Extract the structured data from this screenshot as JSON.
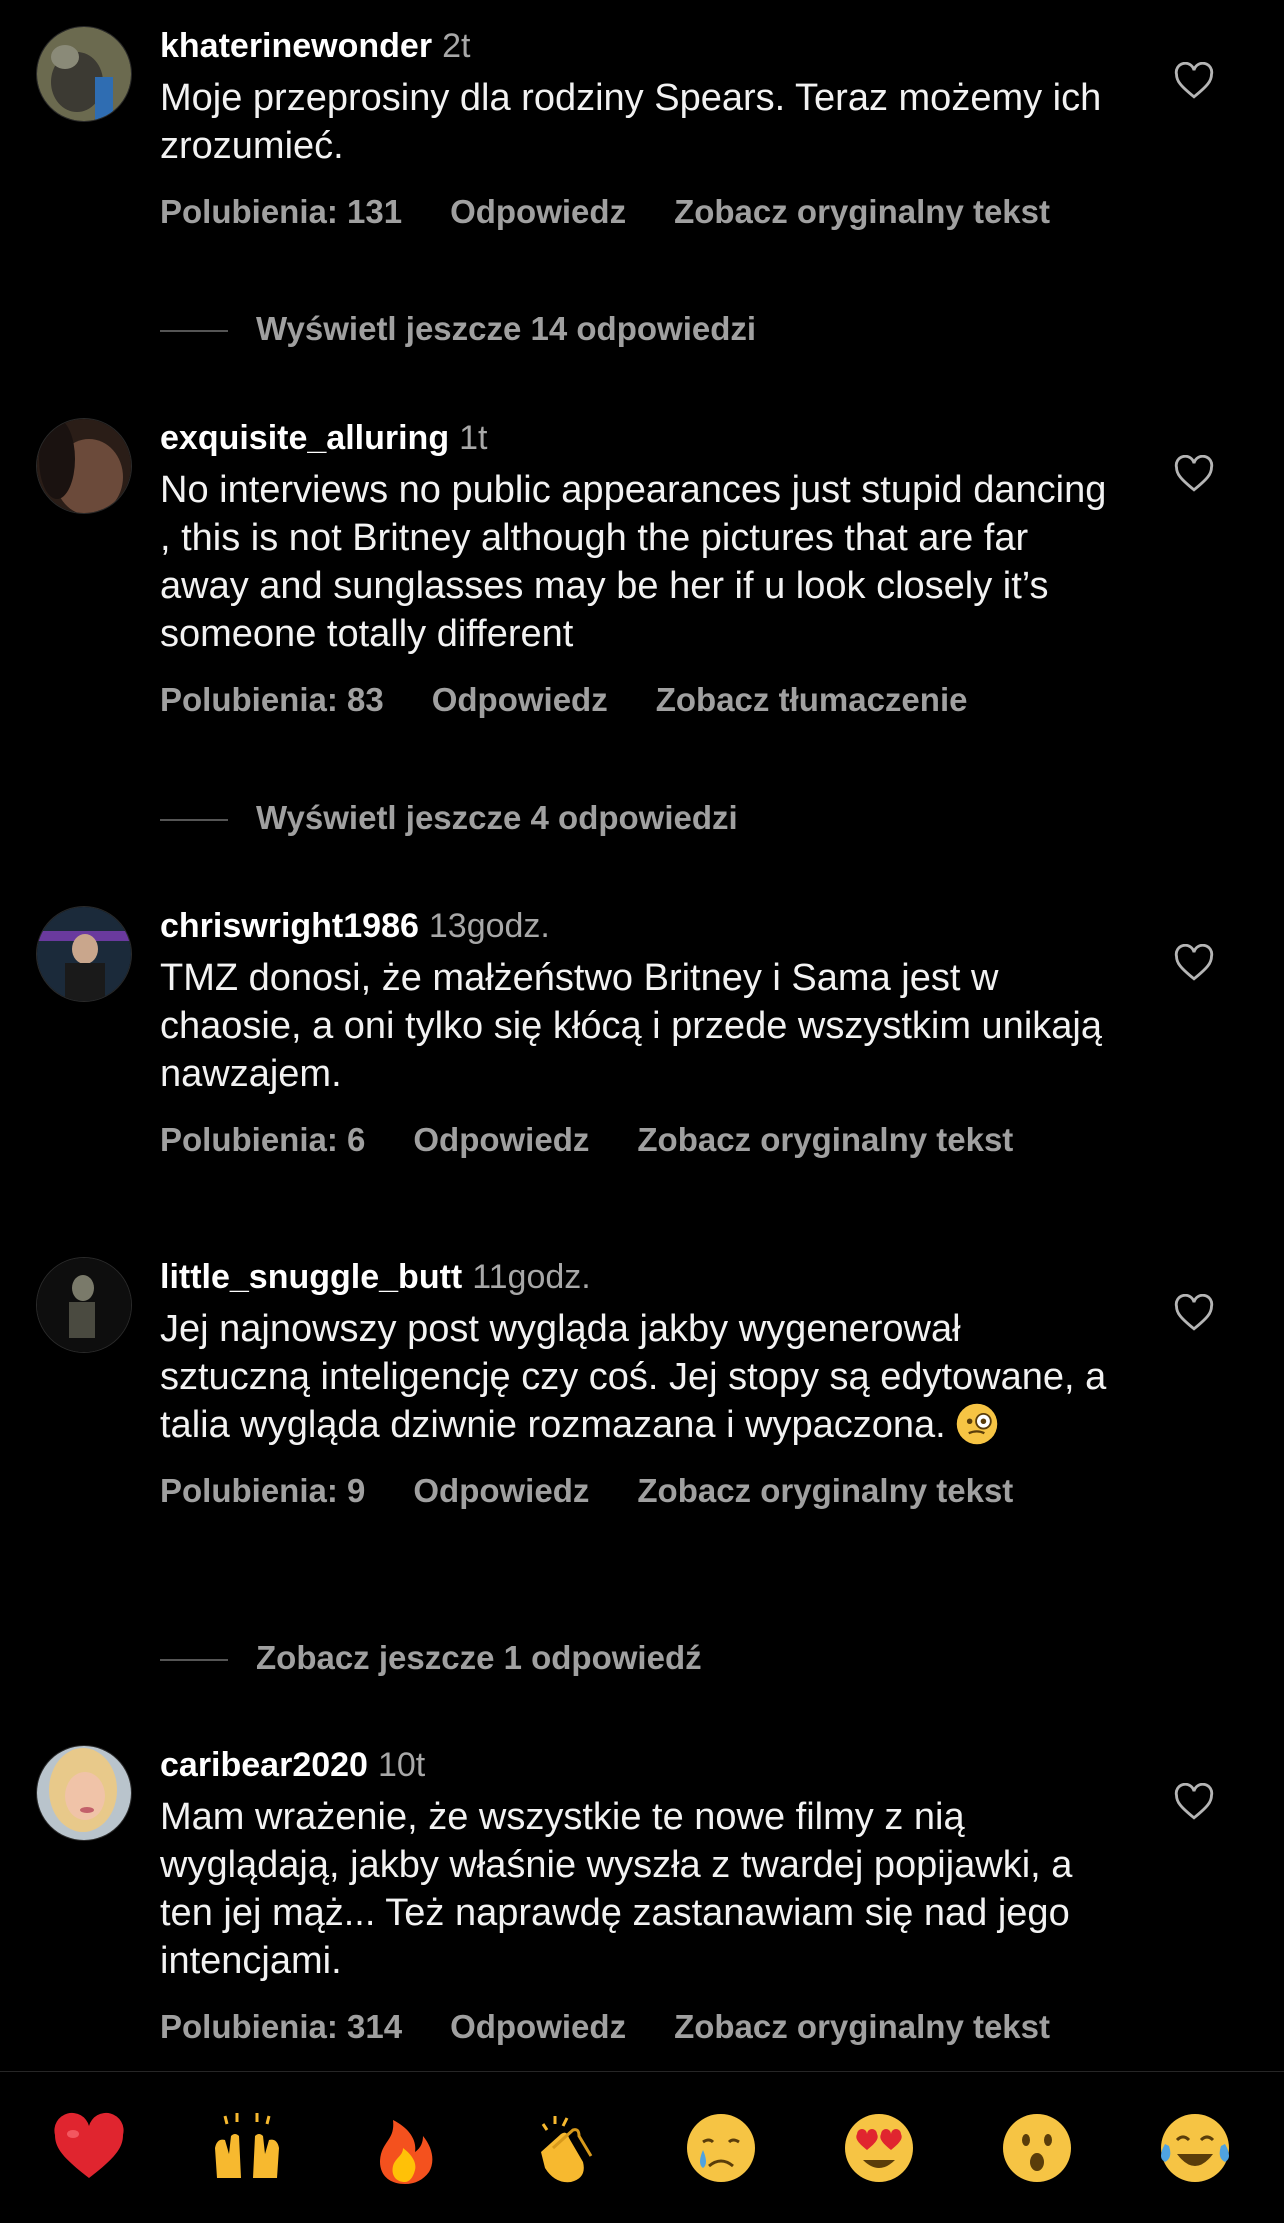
{
  "comments": [
    {
      "username": "khaterinewonder",
      "time": "2t",
      "text": "Moje przeprosiny dla rodziny Spears. Teraz możemy ich zrozumieć.",
      "likes": "Polubienia: 131",
      "reply": "Odpowiedz",
      "translate": "Zobacz oryginalny tekst",
      "more_replies": "Wyświetl jeszcze 14 odpowiedzi"
    },
    {
      "username": "exquisite_alluring",
      "time": "1t",
      "text": "No interviews no public appearances just stupid dancing , this is not Britney although the pictures that are far away and sunglasses may be her if u look closely it’s someone totally different",
      "likes": "Polubienia: 83",
      "reply": "Odpowiedz",
      "translate": "Zobacz tłumaczenie",
      "more_replies": "Wyświetl jeszcze 4 odpowiedzi"
    },
    {
      "username": "chriswright1986",
      "time": "13godz.",
      "text": "TMZ donosi, że małżeństwo Britney i Sama jest w chaosie, a oni tylko się kłócą i przede wszystkim unikają nawzajem.",
      "likes": "Polubienia: 6",
      "reply": "Odpowiedz",
      "translate": "Zobacz oryginalny tekst"
    },
    {
      "username": "little_snuggle_butt",
      "time": "11godz.",
      "text": "Jej najnowszy post wygląda jakby wygenerował sztuczną inteligencję czy coś. Jej stopy są edytowane, a talia wygląda dziwnie rozmazana i wypaczona.",
      "likes": "Polubienia: 9",
      "reply": "Odpowiedz",
      "translate": "Zobacz oryginalny tekst",
      "more_replies": "Zobacz jeszcze 1 odpowiedź"
    },
    {
      "username": "caribear2020",
      "time": "10t",
      "text": "Mam wrażenie, że wszystkie te nowe filmy z nią wyglądają, jakby właśnie wyszła z twardej popijawki, a ten jej mąż... Też naprawdę zastanawiam się nad jego intencjami.",
      "likes": "Polubienia: 314",
      "reply": "Odpowiedz",
      "translate": "Zobacz oryginalny tekst"
    }
  ],
  "emoji_bar": [
    "red-heart",
    "raising-hands",
    "fire",
    "clapping-hands",
    "crying-face",
    "heart-eyes-face",
    "surprised-face",
    "tears-of-joy-face"
  ],
  "colors": {
    "background": "#000000",
    "secondary_text": "#a0a0a0"
  }
}
